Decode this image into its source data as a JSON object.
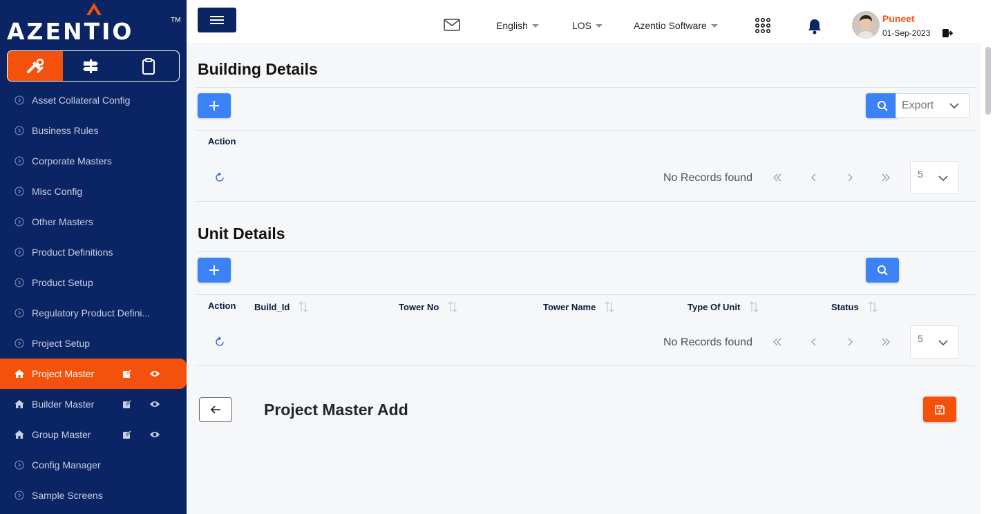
{
  "brand": {
    "logo_text": "AZENTIO",
    "logo_tm": "TM",
    "accent_color": "#f4520c",
    "nav_color": "#0b2463",
    "primary_color": "#3b82f6"
  },
  "sidebar": {
    "tabs": [
      {
        "icon": "tools-icon",
        "active": true
      },
      {
        "icon": "signpost-icon",
        "active": false
      },
      {
        "icon": "clipboard-icon",
        "active": false
      }
    ],
    "items": [
      {
        "label": "Asset Collateral Config",
        "icon": "circle-chevron-icon"
      },
      {
        "label": "Business Rules",
        "icon": "circle-chevron-icon"
      },
      {
        "label": "Corporate Masters",
        "icon": "circle-chevron-icon"
      },
      {
        "label": "Misc Config",
        "icon": "circle-chevron-icon"
      },
      {
        "label": "Other Masters",
        "icon": "circle-chevron-icon"
      },
      {
        "label": "Product Definitions",
        "icon": "circle-chevron-icon"
      },
      {
        "label": "Product Setup",
        "icon": "circle-chevron-icon"
      },
      {
        "label": "Regulatory Product Defini...",
        "icon": "circle-chevron-icon"
      },
      {
        "label": "Project Setup",
        "icon": "circle-chevron-icon"
      },
      {
        "label": "Project Master",
        "icon": "home-icon",
        "active": true
      },
      {
        "label": "Builder Master",
        "icon": "home-icon"
      },
      {
        "label": "Group Master",
        "icon": "home-icon"
      },
      {
        "label": "Config Manager",
        "icon": "circle-chevron-icon"
      },
      {
        "label": "Sample Screens",
        "icon": "circle-chevron-icon"
      }
    ]
  },
  "header": {
    "language": "English",
    "module": "LOS",
    "company": "Azentio Software",
    "user": {
      "name": "Puneet",
      "date": "01-Sep-2023"
    }
  },
  "building_details": {
    "title": "Building Details",
    "export_label": "Export",
    "columns": [
      "Action"
    ],
    "empty_text": "No Records found",
    "page_size": "5"
  },
  "unit_details": {
    "title": "Unit Details",
    "columns": [
      "Action",
      "Build_Id",
      "Tower No",
      "Tower Name",
      "Type Of Unit",
      "Status"
    ],
    "empty_text": "No Records found",
    "page_size": "5"
  },
  "page": {
    "title": "Project Master Add"
  }
}
